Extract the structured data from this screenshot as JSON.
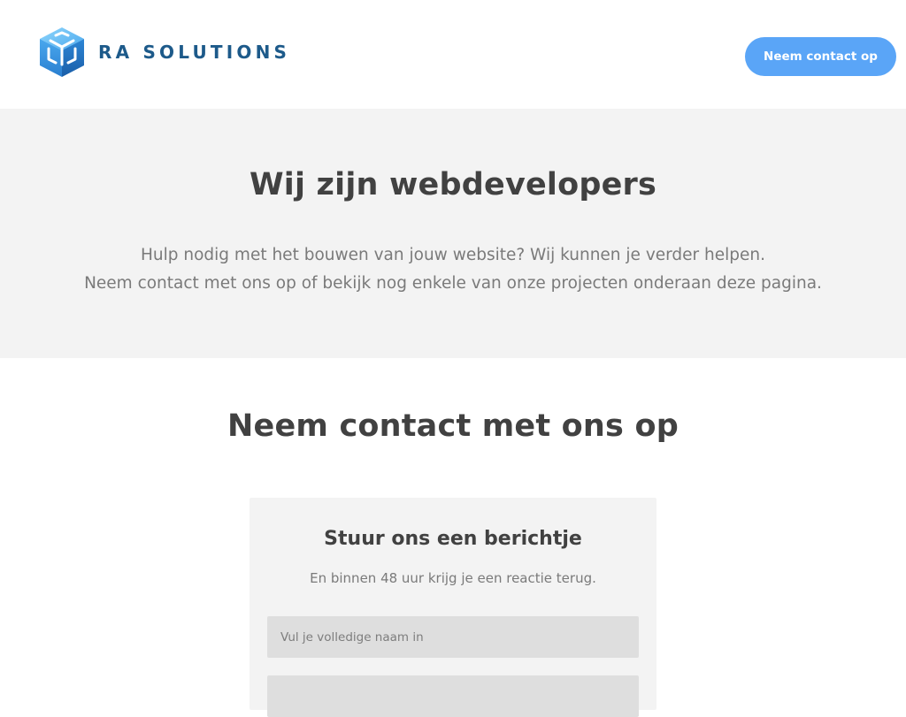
{
  "header": {
    "logo_text": "RA SOLUTIONS",
    "contact_button": "Neem contact op"
  },
  "hero": {
    "title": "Wij zijn webdevelopers",
    "line1": "Hulp nodig met het bouwen van jouw website? Wij kunnen je verder helpen.",
    "line2": "Neem contact met ons op of bekijk nog enkele van onze projecten onderaan deze pagina."
  },
  "contact": {
    "title": "Neem contact met ons op",
    "form": {
      "title": "Stuur ons een berichtje",
      "subtitle": "En binnen 48 uur krijg je een reactie terug.",
      "name_placeholder": "Vul je volledige naam in",
      "name_value": "",
      "email_value": ""
    }
  },
  "colors": {
    "accent": "#5aa5f7",
    "brand": "#1d5a8a",
    "section_bg": "#f3f3f3"
  }
}
